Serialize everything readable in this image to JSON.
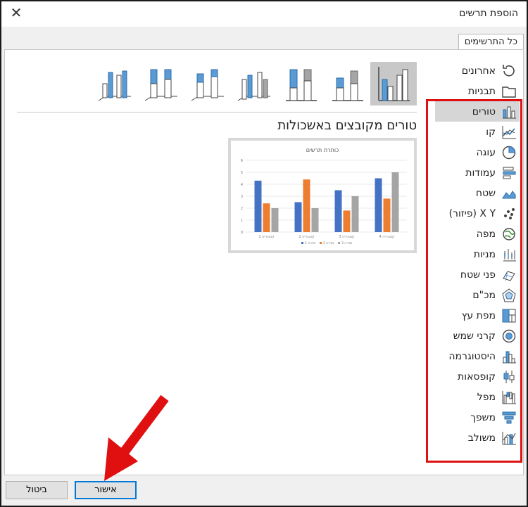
{
  "window": {
    "title": "הוספת תרשים"
  },
  "tab": {
    "label": "כל התרשימים"
  },
  "categories": [
    {
      "label": "אחרונים",
      "icon": "recent-icon"
    },
    {
      "label": "תבניות",
      "icon": "folder-icon"
    },
    {
      "label": "טורים",
      "icon": "column-chart-icon",
      "selected": true
    },
    {
      "label": "קו",
      "icon": "line-chart-icon"
    },
    {
      "label": "עוגה",
      "icon": "pie-chart-icon"
    },
    {
      "label": "עמודות",
      "icon": "bar-chart-icon"
    },
    {
      "label": "שטח",
      "icon": "area-chart-icon"
    },
    {
      "label": "X Y (פיזור)",
      "icon": "scatter-chart-icon"
    },
    {
      "label": "מפה",
      "icon": "map-chart-icon"
    },
    {
      "label": "מניות",
      "icon": "stock-chart-icon"
    },
    {
      "label": "פני שטח",
      "icon": "surface-chart-icon"
    },
    {
      "label": "מכ\"ם",
      "icon": "radar-chart-icon"
    },
    {
      "label": "מפת עץ",
      "icon": "treemap-chart-icon"
    },
    {
      "label": "קרני שמש",
      "icon": "sunburst-chart-icon"
    },
    {
      "label": "היסטוגרמה",
      "icon": "histogram-chart-icon"
    },
    {
      "label": "קופסאות",
      "icon": "box-whisker-icon"
    },
    {
      "label": "מפל",
      "icon": "waterfall-chart-icon"
    },
    {
      "label": "משפך",
      "icon": "funnel-chart-icon"
    },
    {
      "label": "משולב",
      "icon": "combo-chart-icon"
    }
  ],
  "subtype": {
    "title": "טורים מקובצים באשכולות"
  },
  "preview": {
    "chart_title": "כותרת תרשים",
    "categories": [
      "קטגוריה 1",
      "קטגוריה 2",
      "קטגוריה 3",
      "קטגוריה 4"
    ],
    "series": [
      {
        "name": "סדרה 1",
        "values": [
          4.3,
          2.5,
          3.5,
          4.5
        ],
        "color": "#4472c4"
      },
      {
        "name": "סדרה 2",
        "values": [
          2.4,
          4.4,
          1.8,
          2.8
        ],
        "color": "#ed7d31"
      },
      {
        "name": "סדרה 3",
        "values": [
          2,
          2,
          3,
          5
        ],
        "color": "#a5a5a5"
      }
    ],
    "y_ticks": [
      "0",
      "1",
      "2",
      "3",
      "4",
      "5",
      "6"
    ]
  },
  "buttons": {
    "ok": "אישור",
    "cancel": "ביטול"
  },
  "colors": {
    "highlight": "#dd1111",
    "accent": "#0078d7",
    "chart_blue": "#5b9bd5"
  }
}
